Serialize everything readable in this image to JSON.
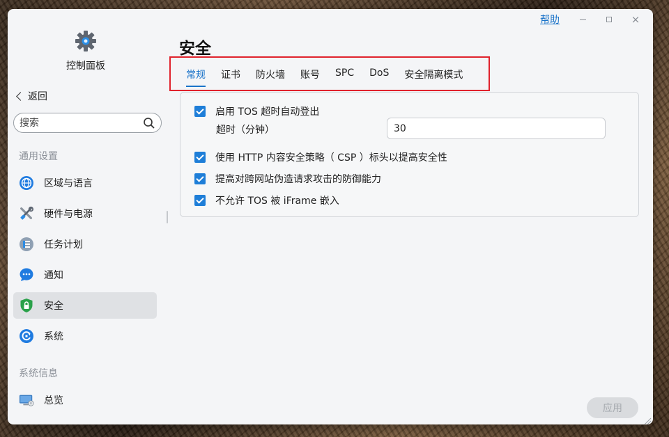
{
  "window": {
    "help_label": "帮助",
    "minimize_label": "–",
    "maximize_label": "",
    "close_label": "×"
  },
  "sidebar": {
    "app_title": "控制面板",
    "back_label": "返回",
    "search_placeholder": "搜索",
    "section_general": "通用设置",
    "section_sysinfo": "系统信息",
    "items": [
      {
        "label": "区域与语言",
        "icon": "globe-icon"
      },
      {
        "label": "硬件与电源",
        "icon": "tools-icon"
      },
      {
        "label": "任务计划",
        "icon": "task-list-icon"
      },
      {
        "label": "通知",
        "icon": "chat-bubble-icon"
      },
      {
        "label": "安全",
        "icon": "shield-lock-icon",
        "active": true
      },
      {
        "label": "系统",
        "icon": "system-refresh-icon"
      },
      {
        "label": "总览",
        "icon": "monitor-icon"
      }
    ]
  },
  "main": {
    "title": "安全",
    "tabs": [
      "常规",
      "证书",
      "防火墙",
      "账号",
      "SPC",
      "DoS",
      "安全隔离模式"
    ],
    "active_tab": "常规",
    "options": {
      "auto_logout": "启用 TOS 超时自动登出",
      "timeout_label": "超时（分钟）",
      "timeout_value": "30",
      "csp": "使用 HTTP 内容安全策略（ CSP ）标头以提高安全性",
      "csrf": "提高对跨网站伪造请求攻击的防御能力",
      "iframe": "不允许 TOS 被 iFrame 嵌入"
    },
    "apply_label": "应用"
  },
  "colors": {
    "accent": "#1a73c9",
    "checkbox": "#1e7ed8",
    "highlight_box": "#e0222c"
  }
}
